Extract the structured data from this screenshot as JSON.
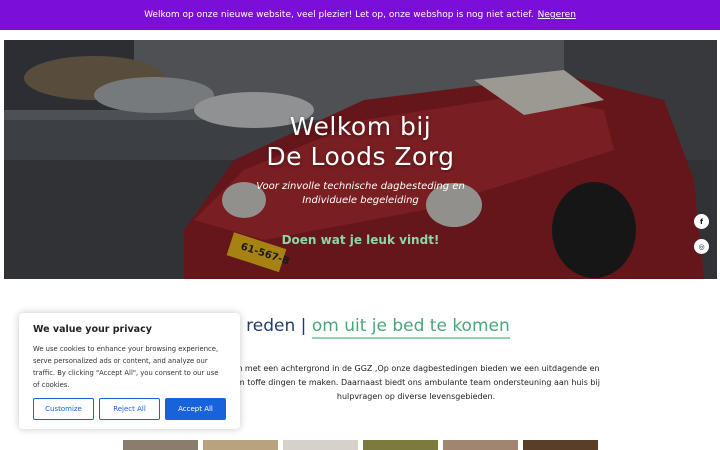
{
  "notice": {
    "text": "Welkom op onze nieuwe website, veel plezier! Let op, onze webshop is nog niet actief.",
    "dismiss_label": "Negeren"
  },
  "hero": {
    "title_line1": "Welkom bij",
    "title_line2": "De Loods Zorg",
    "subtitle_line1": "Voor zinvolle technische dagbesteding en",
    "subtitle_line2": "Individuele begeleiding",
    "cta": "Doen wat je leuk vindt!",
    "license_plate": "61-567-B"
  },
  "social": {
    "facebook_icon": "facebook-icon",
    "instagram_icon": "instagram-icon"
  },
  "section": {
    "title_start": "n reden |",
    "title_accent": "om uit je bed te komen",
    "intro": "en met een achtergrond in de GGZ ,Op onze dagbestedingen bieden we een uitdagende en om toffe dingen te maken. Daarnaast biedt ons ambulante team ondersteuning aan huis bij hulpvragen op diverse levensgebieden."
  },
  "cookie": {
    "title": "We value your privacy",
    "body": "We use cookies to enhance your browsing experience, serve personalized ads or content, and analyze our traffic. By clicking \"Accept All\", you consent to our use of cookies.",
    "customize_label": "Customize",
    "reject_label": "Reject All",
    "accept_label": "Accept All"
  },
  "colors": {
    "notice_bg": "#7b0fd9",
    "accent_green": "#49a57a",
    "title_blue": "#1f3b6f",
    "cookie_blue": "#1863dc"
  }
}
